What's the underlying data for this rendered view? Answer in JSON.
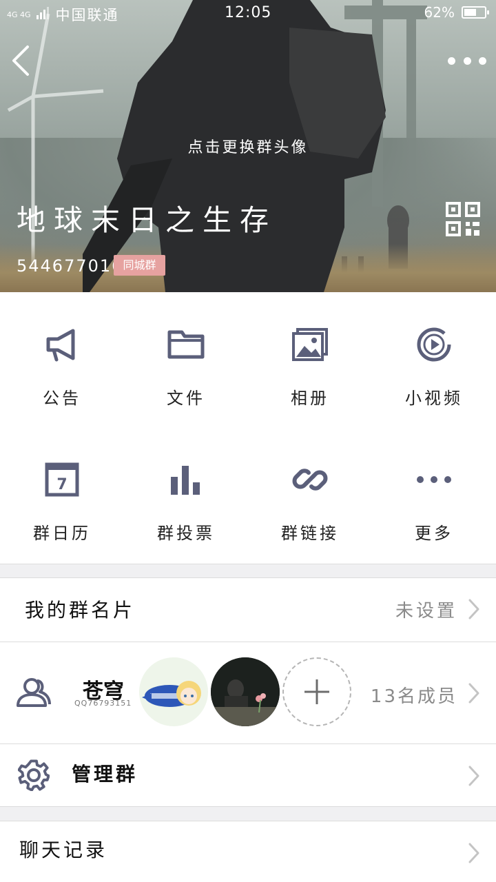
{
  "status_bar": {
    "signal": "4G 4G",
    "carrier": "中国联通",
    "time": "12:05",
    "battery": "62%",
    "battery_level": 0.62
  },
  "header": {
    "change_avatar_hint": "点击更换群头像",
    "group_name": "地球末日之生存",
    "group_id": "544677016",
    "group_tag": "同城群"
  },
  "features": [
    {
      "label": "公告",
      "icon": "megaphone-icon"
    },
    {
      "label": "文件",
      "icon": "folder-icon"
    },
    {
      "label": "相册",
      "icon": "photo-album-icon"
    },
    {
      "label": "小视频",
      "icon": "video-play-icon"
    },
    {
      "label": "群日历",
      "icon": "calendar-icon"
    },
    {
      "label": "群投票",
      "icon": "bar-chart-icon"
    },
    {
      "label": "群链接",
      "icon": "link-icon"
    },
    {
      "label": "更多",
      "icon": "more-dots-icon"
    }
  ],
  "card": {
    "title": "我的群名片",
    "value": "未设置"
  },
  "members": {
    "owner_name": "苍穹",
    "owner_qq": "QQ76793151",
    "count": "13名成员"
  },
  "manage": {
    "title": "管理群"
  },
  "history": {
    "title": "聊天记录"
  },
  "colors": {
    "icon": "#5b5f7a",
    "tag": "#e6a2a0",
    "chevron": "#c4c4c4"
  }
}
